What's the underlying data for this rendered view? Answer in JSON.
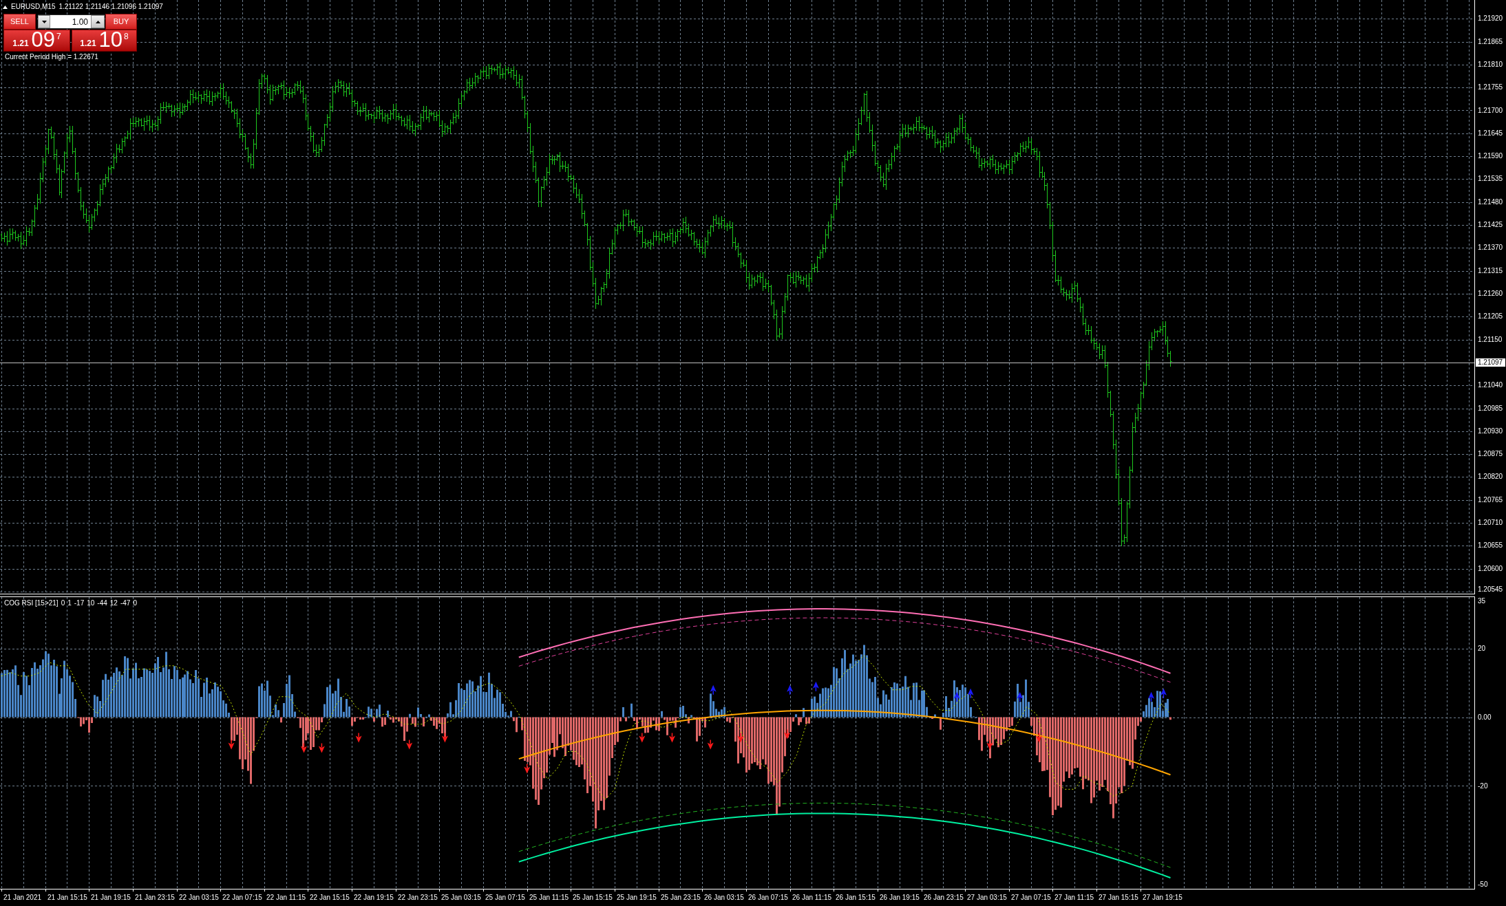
{
  "chart_header": {
    "symbol": "EURUSD,M15",
    "ohlc": "1.21122 1.21146 1.21096 1.21097"
  },
  "trade_panel": {
    "sell_label": "SELL",
    "buy_label": "BUY",
    "volume": "1.00",
    "sell_price": {
      "handle": "1.21",
      "pips": "09",
      "point": "7"
    },
    "buy_price": {
      "handle": "1.21",
      "pips": "10",
      "point": "8"
    }
  },
  "info_text": "Current Period High = 1.22671",
  "price_axis": {
    "labels": [
      {
        "kind": "tick",
        "text": "1.21920"
      },
      {
        "kind": "tick",
        "text": "1.21865"
      },
      {
        "kind": "tick",
        "text": "1.21810"
      },
      {
        "kind": "tick",
        "text": "1.21755"
      },
      {
        "kind": "tick",
        "text": "1.21700"
      },
      {
        "kind": "tick",
        "text": "1.21645"
      },
      {
        "kind": "tick",
        "text": "1.21590"
      },
      {
        "kind": "tick",
        "text": "1.21535"
      },
      {
        "kind": "tick",
        "text": "1.21480"
      },
      {
        "kind": "tick",
        "text": "1.21425"
      },
      {
        "kind": "tick",
        "text": "1.21370"
      },
      {
        "kind": "tick",
        "text": "1.21315"
      },
      {
        "kind": "tick",
        "text": "1.21260"
      },
      {
        "kind": "tick",
        "text": "1.21205"
      },
      {
        "kind": "tick",
        "text": "1.21150"
      },
      {
        "kind": "current",
        "text": "1.21097"
      },
      {
        "kind": "tick",
        "text": "1.21040"
      },
      {
        "kind": "tick",
        "text": "1.20985"
      },
      {
        "kind": "tick",
        "text": "1.20930"
      },
      {
        "kind": "tick",
        "text": "1.20875"
      },
      {
        "kind": "tick",
        "text": "1.20820"
      },
      {
        "kind": "tick",
        "text": "1.20765"
      },
      {
        "kind": "tick",
        "text": "1.20710"
      },
      {
        "kind": "tick",
        "text": "1.20655"
      },
      {
        "kind": "tick",
        "text": "1.20600"
      },
      {
        "kind": "tick",
        "text": "1.20545"
      }
    ]
  },
  "indicator": {
    "name": "COG RSI [15>21]",
    "values": [
      "0",
      "1",
      "-17",
      "10",
      "-44",
      "12",
      "-47",
      "0"
    ],
    "axis_labels": [
      "35",
      "20",
      "0.00",
      "-20",
      "-50"
    ]
  },
  "time_axis": {
    "labels": [
      "21 Jan 2021",
      "21 Jan 15:15",
      "21 Jan 19:15",
      "21 Jan 23:15",
      "22 Jan 03:15",
      "22 Jan 07:15",
      "22 Jan 11:15",
      "22 Jan 15:15",
      "22 Jan 19:15",
      "22 Jan 23:15",
      "25 Jan 03:15",
      "25 Jan 07:15",
      "25 Jan 11:15",
      "25 Jan 15:15",
      "25 Jan 19:15",
      "25 Jan 23:15",
      "26 Jan 03:15",
      "26 Jan 07:15",
      "26 Jan 11:15",
      "26 Jan 15:15",
      "26 Jan 19:15",
      "26 Jan 23:15",
      "27 Jan 03:15",
      "27 Jan 07:15",
      "27 Jan 11:15",
      "27 Jan 15:15",
      "27 Jan 19:15"
    ]
  }
}
